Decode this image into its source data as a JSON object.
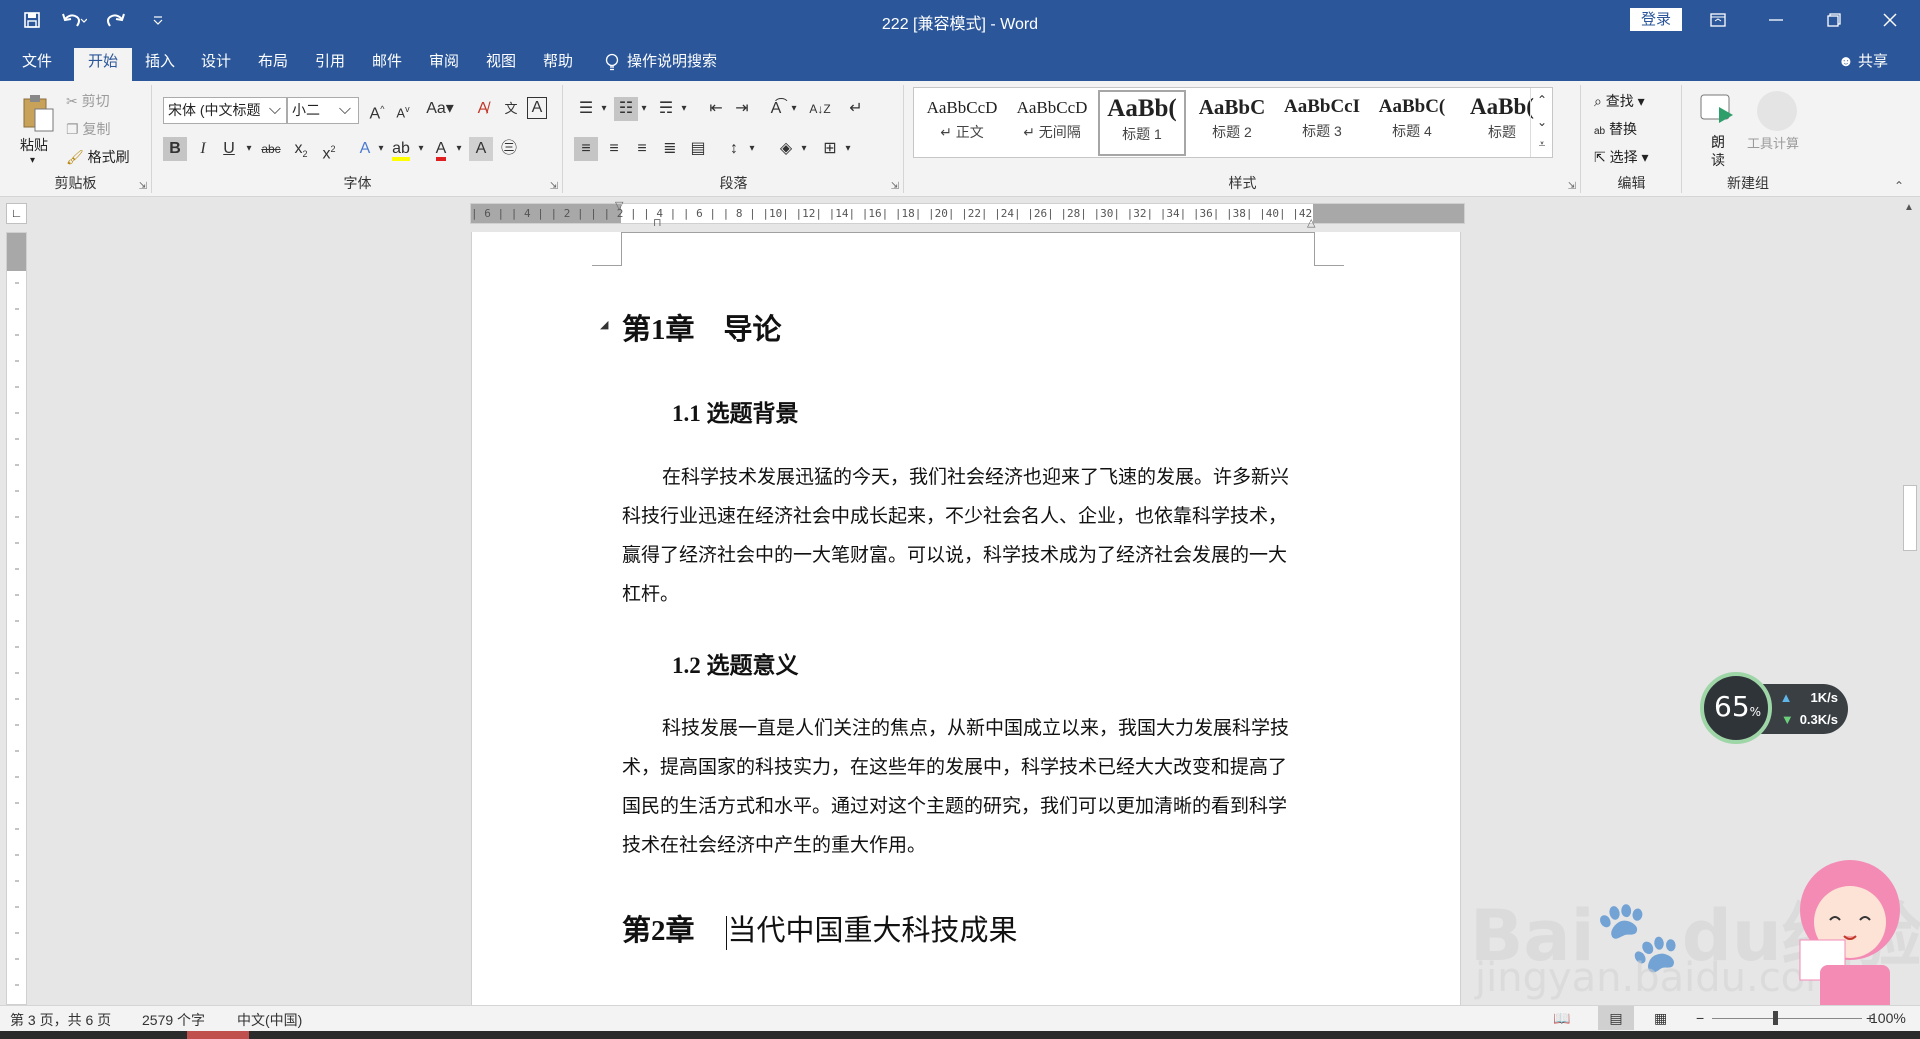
{
  "window": {
    "title": "222 [兼容模式] - Word",
    "login_label": "登录"
  },
  "qat": {
    "save_icon": "save-icon",
    "undo_icon": "undo-icon",
    "redo_icon": "redo-icon",
    "customize_icon": "customize-icon"
  },
  "tabs": [
    {
      "label": "文件"
    },
    {
      "label": "开始"
    },
    {
      "label": "插入"
    },
    {
      "label": "设计"
    },
    {
      "label": "布局"
    },
    {
      "label": "引用"
    },
    {
      "label": "邮件"
    },
    {
      "label": "审阅"
    },
    {
      "label": "视图"
    },
    {
      "label": "帮助"
    }
  ],
  "tell_me": "操作说明搜索",
  "share_label": "共享",
  "ribbon": {
    "clipboard": {
      "paste": "粘贴",
      "cut": "剪切",
      "copy": "复制",
      "format_painter": "格式刷",
      "label": "剪贴板"
    },
    "font": {
      "font_name": "宋体 (中文标题",
      "font_size": "小二",
      "change_case": "Aa",
      "label": "字体"
    },
    "paragraph": {
      "label": "段落"
    },
    "styles": {
      "label": "样式",
      "items": [
        {
          "sample": "AaBbCcD",
          "name": "↵ 正文"
        },
        {
          "sample": "AaBbCcD",
          "name": "↵ 无间隔"
        },
        {
          "sample": "AaBb(",
          "name": "标题 1"
        },
        {
          "sample": "AaBbC",
          "name": "标题 2"
        },
        {
          "sample": "AaBbCcI",
          "name": "标题 3"
        },
        {
          "sample": "AaBbC(",
          "name": "标题 4"
        },
        {
          "sample": "AaBb(",
          "name": "标题"
        }
      ]
    },
    "editing": {
      "find": "查找",
      "replace": "替换",
      "select": "选择",
      "label": "编辑"
    },
    "newgroup": {
      "read_aloud": "朗读",
      "tool_calc": "工具计算",
      "label": "新建组"
    }
  },
  "ruler": {
    "horizontal": "| 6 |  | 4 |  | 2 |  |    | 2 |  | 4 |  | 6 |  | 8 |  |10|  |12|  |14|  |16|  |18|  |20|  |22|  |24|  |26|  |28|  |30|  |32|  |34|  |36|  |38|  |40|  |42"
  },
  "document": {
    "h1_chapter1": "第1章　导论",
    "h2_1_1": "1.1 选题背景",
    "para1": [
      "在科学技术发展迅猛的今天，我们社会经济也迎来了飞速的发展。许多新兴",
      "科技行业迅速在经济社会中成长起来，不少社会名人、企业，也依靠科学技术，",
      "赢得了经济社会中的一大笔财富。可以说，科学技术成为了经济社会发展的一大",
      "杠杆。"
    ],
    "h2_1_2": "1.2 选题意义",
    "para2": [
      "科技发展一直是人们关注的焦点，从新中国成立以来，我国大力发展科学技",
      "术，提高国家的科技实力，在这些年的发展中，科学技术已经大大改变和提高了",
      "国民的生活方式和水平。通过对这个主题的研究，我们可以更加清晰的看到科学",
      "技术在社会经济中产生的重大作用。"
    ],
    "h1_chapter2_prefix": "第2章",
    "h1_chapter2_title": "当代中国重大科技成果"
  },
  "status": {
    "page": "第 3 页，共 6 页",
    "words": "2579 个字",
    "language": "中文(中国)",
    "zoom": "100%"
  },
  "net_widget": {
    "percent": "65",
    "percent_unit": "%",
    "up": "1K/s",
    "down": "0.3K/s"
  },
  "watermark": {
    "line1": "Bai",
    "line1b": "du",
    "line1c": "经验",
    "line2": "jingyan.baidu.com"
  },
  "colors": {
    "brand": "#2b579a",
    "ribbon_bg": "#f3f3f3"
  }
}
